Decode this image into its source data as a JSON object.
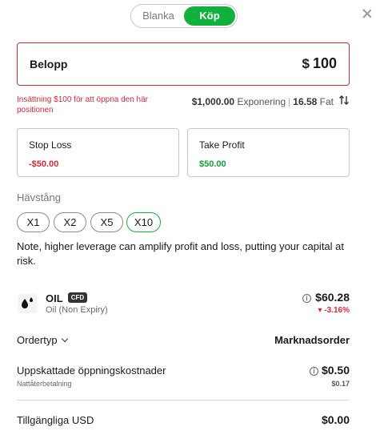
{
  "toggle": {
    "sell_label": "Blanka",
    "buy_label": "Köp",
    "selected": "Köp"
  },
  "amount": {
    "label": "Belopp",
    "currency": "$",
    "value": "100"
  },
  "warning": "Insättning $100 för att öppna den här positionen",
  "exposure": {
    "value": "$1,000.00",
    "label": "Exponering",
    "units": "16.58",
    "units_label": "Fat"
  },
  "stop_loss": {
    "label": "Stop Loss",
    "value": "-$50.00"
  },
  "take_profit": {
    "label": "Take Profit",
    "value": "$50.00"
  },
  "leverage": {
    "title": "Hävstång",
    "options": [
      "X1",
      "X2",
      "X5",
      "X10"
    ],
    "selected": "X10",
    "note": "Note, higher leverage can amplify profit and loss, putting your capital at risk."
  },
  "instrument": {
    "symbol": "OIL",
    "badge": "CFD",
    "name": "Oil (Non Expiry)",
    "price": "$60.28",
    "change": "-3.16%",
    "icon": "oil-drop-icon"
  },
  "order_type": {
    "label": "Ordertyp",
    "value": "Marknadsorder"
  },
  "estimated_cost": {
    "label": "Uppskattade öppningskostnader",
    "value": "$0.50",
    "sub_label": "Nattåterbetalning",
    "sub_value": "$0.17"
  },
  "available": {
    "label": "Tillgängliga USD",
    "value": "$0.00"
  },
  "colors": {
    "accent_green": "#12b03d",
    "error_red": "#d6283a"
  }
}
